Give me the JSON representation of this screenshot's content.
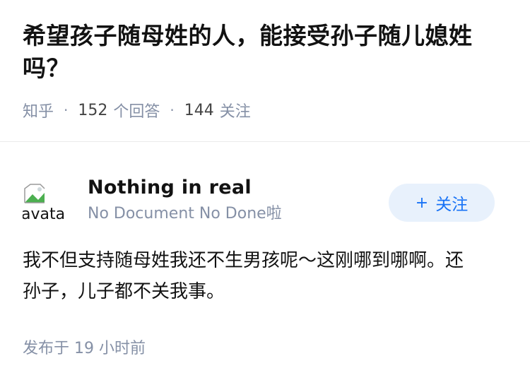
{
  "question": {
    "title": "希望孩子随母姓的人，能接受孙子随儿媳姓吗？",
    "source": "知乎",
    "answer_count": "152",
    "answer_label": "个回答",
    "follower_count": "144",
    "follower_label": "关注",
    "separator": "·"
  },
  "answer": {
    "author": {
      "name": "Nothing in real",
      "bio": "No Document No Done啦",
      "avatar_alt": "avatar"
    },
    "follow_button": {
      "icon": "+",
      "label": "关注"
    },
    "content": "我不但支持随母姓我还不生男孩呢～这刚哪到哪啊。还孙子，儿子都不关我事。",
    "time_prefix": "发布于",
    "time": "19 小时前"
  },
  "colors": {
    "accent": "#1772f6",
    "follow_bg": "#e8f1fc",
    "meta_gray": "#8590a6"
  }
}
